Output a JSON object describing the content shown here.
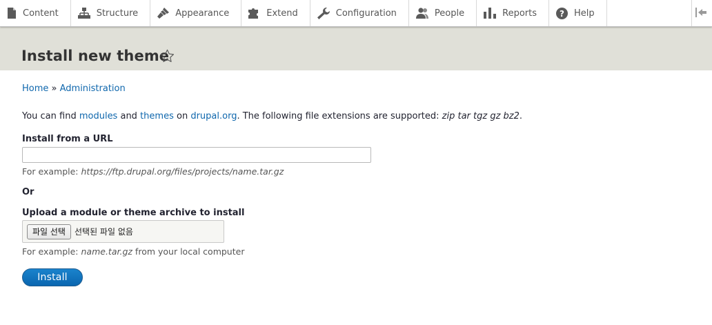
{
  "toolbar": {
    "items": [
      {
        "label": "Content",
        "icon": "file-icon"
      },
      {
        "label": "Structure",
        "icon": "structure-icon"
      },
      {
        "label": "Appearance",
        "icon": "paintbrush-icon"
      },
      {
        "label": "Extend",
        "icon": "puzzle-icon"
      },
      {
        "label": "Configuration",
        "icon": "wrench-icon"
      },
      {
        "label": "People",
        "icon": "people-icon"
      },
      {
        "label": "Reports",
        "icon": "bar-chart-icon"
      },
      {
        "label": "Help",
        "icon": "help-icon"
      }
    ],
    "toggle_icon": "collapse-toolbar-icon"
  },
  "header": {
    "title": "Install new theme",
    "star_icon": "star-outline-icon"
  },
  "breadcrumb": {
    "home": "Home",
    "separator": " » ",
    "admin": "Administration"
  },
  "intro": {
    "prefix": "You can find ",
    "modules_link": "modules",
    "and": " and ",
    "themes_link": "themes",
    "on": " on ",
    "drupal_link": "drupal.org",
    "suffix": ". The following file extensions are supported: ",
    "extensions": "zip tar tgz gz bz2",
    "end": "."
  },
  "form": {
    "url_label": "Install from a URL",
    "url_value": "",
    "url_desc_prefix": "For example: ",
    "url_desc_example": "https://ftp.drupal.org/files/projects/name.tar.gz",
    "or_label": "Or",
    "upload_label": "Upload a module or theme archive to install",
    "file_button": "파일 선택",
    "file_status": "선택된 파일 없음",
    "upload_desc_prefix": "For example: ",
    "upload_desc_example": "name.tar.gz",
    "upload_desc_suffix": " from your local computer",
    "install_button": "Install"
  },
  "colors": {
    "link": "#0f67ad",
    "header_bg": "#e0e0d8",
    "button": "#0a66b0"
  }
}
